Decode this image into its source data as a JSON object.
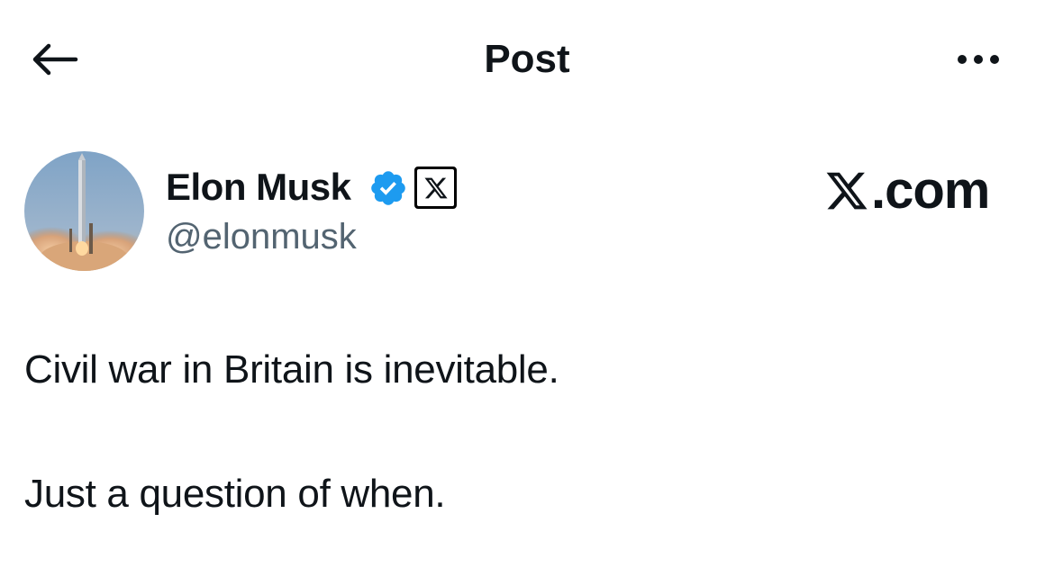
{
  "header": {
    "title": "Post",
    "back_icon": "arrow-left-icon",
    "more_icon": "more-horizontal-icon"
  },
  "author": {
    "name": "Elon Musk",
    "handle": "@elonmusk",
    "verified_icon": "verified-badge-icon",
    "verified_color": "#1d9bf0",
    "affiliate_icon": "x-logo-icon"
  },
  "watermark": {
    "text": ".com"
  },
  "post": {
    "paragraphs": [
      "Civil war in Britain is inevitable.",
      "Just a question of when."
    ]
  },
  "colors": {
    "text_primary": "#0f1419",
    "text_secondary": "#536471",
    "background": "#ffffff"
  }
}
